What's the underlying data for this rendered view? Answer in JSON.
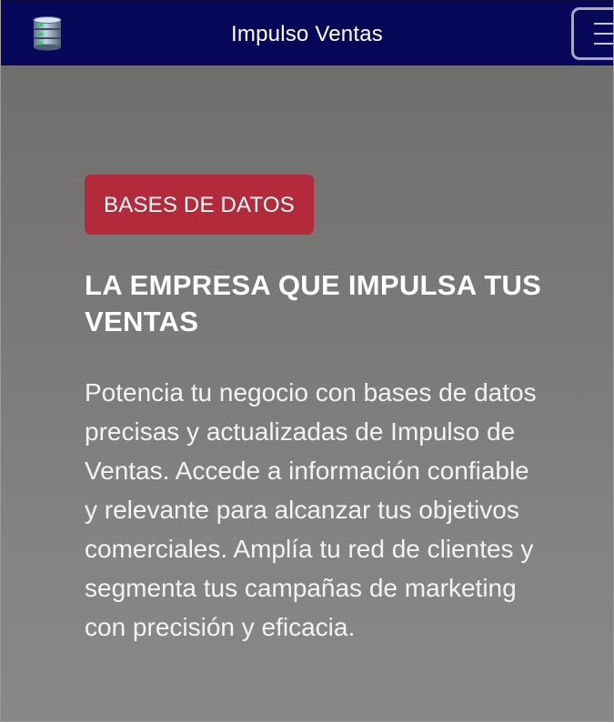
{
  "navbar": {
    "brand_icon": "database-icon",
    "title": "Impulso Ventas",
    "menu_icon": "hamburger-menu-icon"
  },
  "hero": {
    "badge_label": "BASES DE DATOS",
    "title": "LA EMPRESA QUE IMPULSA TUS VENTAS",
    "description": "Potencia tu negocio con bases de datos precisas y actualizadas de Impulso de Ventas. Accede a información confiable y relevante para alcanzar tus objetivos comerciales. Amplía tu red de clientes y segmenta tus campañas de marketing con precisión y eficacia."
  },
  "colors": {
    "navbar_bg": "#08085a",
    "badge_bg": "#b32a3b",
    "hero_bg": "#7a7876",
    "text": "#ffffff"
  }
}
